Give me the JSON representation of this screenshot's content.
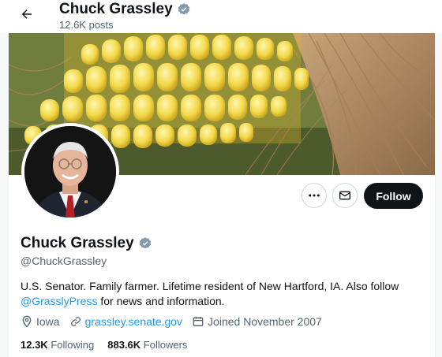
{
  "header": {
    "title": "Chuck Grassley",
    "posts": "12.6K posts"
  },
  "profile": {
    "name": "Chuck Grassley",
    "handle": "@ChuckGrassley",
    "bio_prefix": "U.S. Senator. Family farmer. Lifetime resident of New Hartford, IA. Also follow",
    "bio_link": "@GrasslyPress",
    "bio_suffix": " for news and information.",
    "location": "Iowa",
    "website": "grassley.senate.gov",
    "joined": "Joined November 2007",
    "following_count": "12.3K",
    "following_label": "Following",
    "followers_count": "883.6K",
    "followers_label": "Followers"
  },
  "actions": {
    "follow_label": "Follow"
  },
  "icons": {
    "back": "arrow-left-icon",
    "verified": "verified-badge-icon",
    "more": "more-icon",
    "message": "envelope-icon",
    "location": "location-pin-icon",
    "link": "link-icon",
    "calendar": "calendar-icon"
  },
  "colors": {
    "accent": "#1d9bf0",
    "text": "#0f1419",
    "secondary": "#536471",
    "verified": "#829aab"
  }
}
